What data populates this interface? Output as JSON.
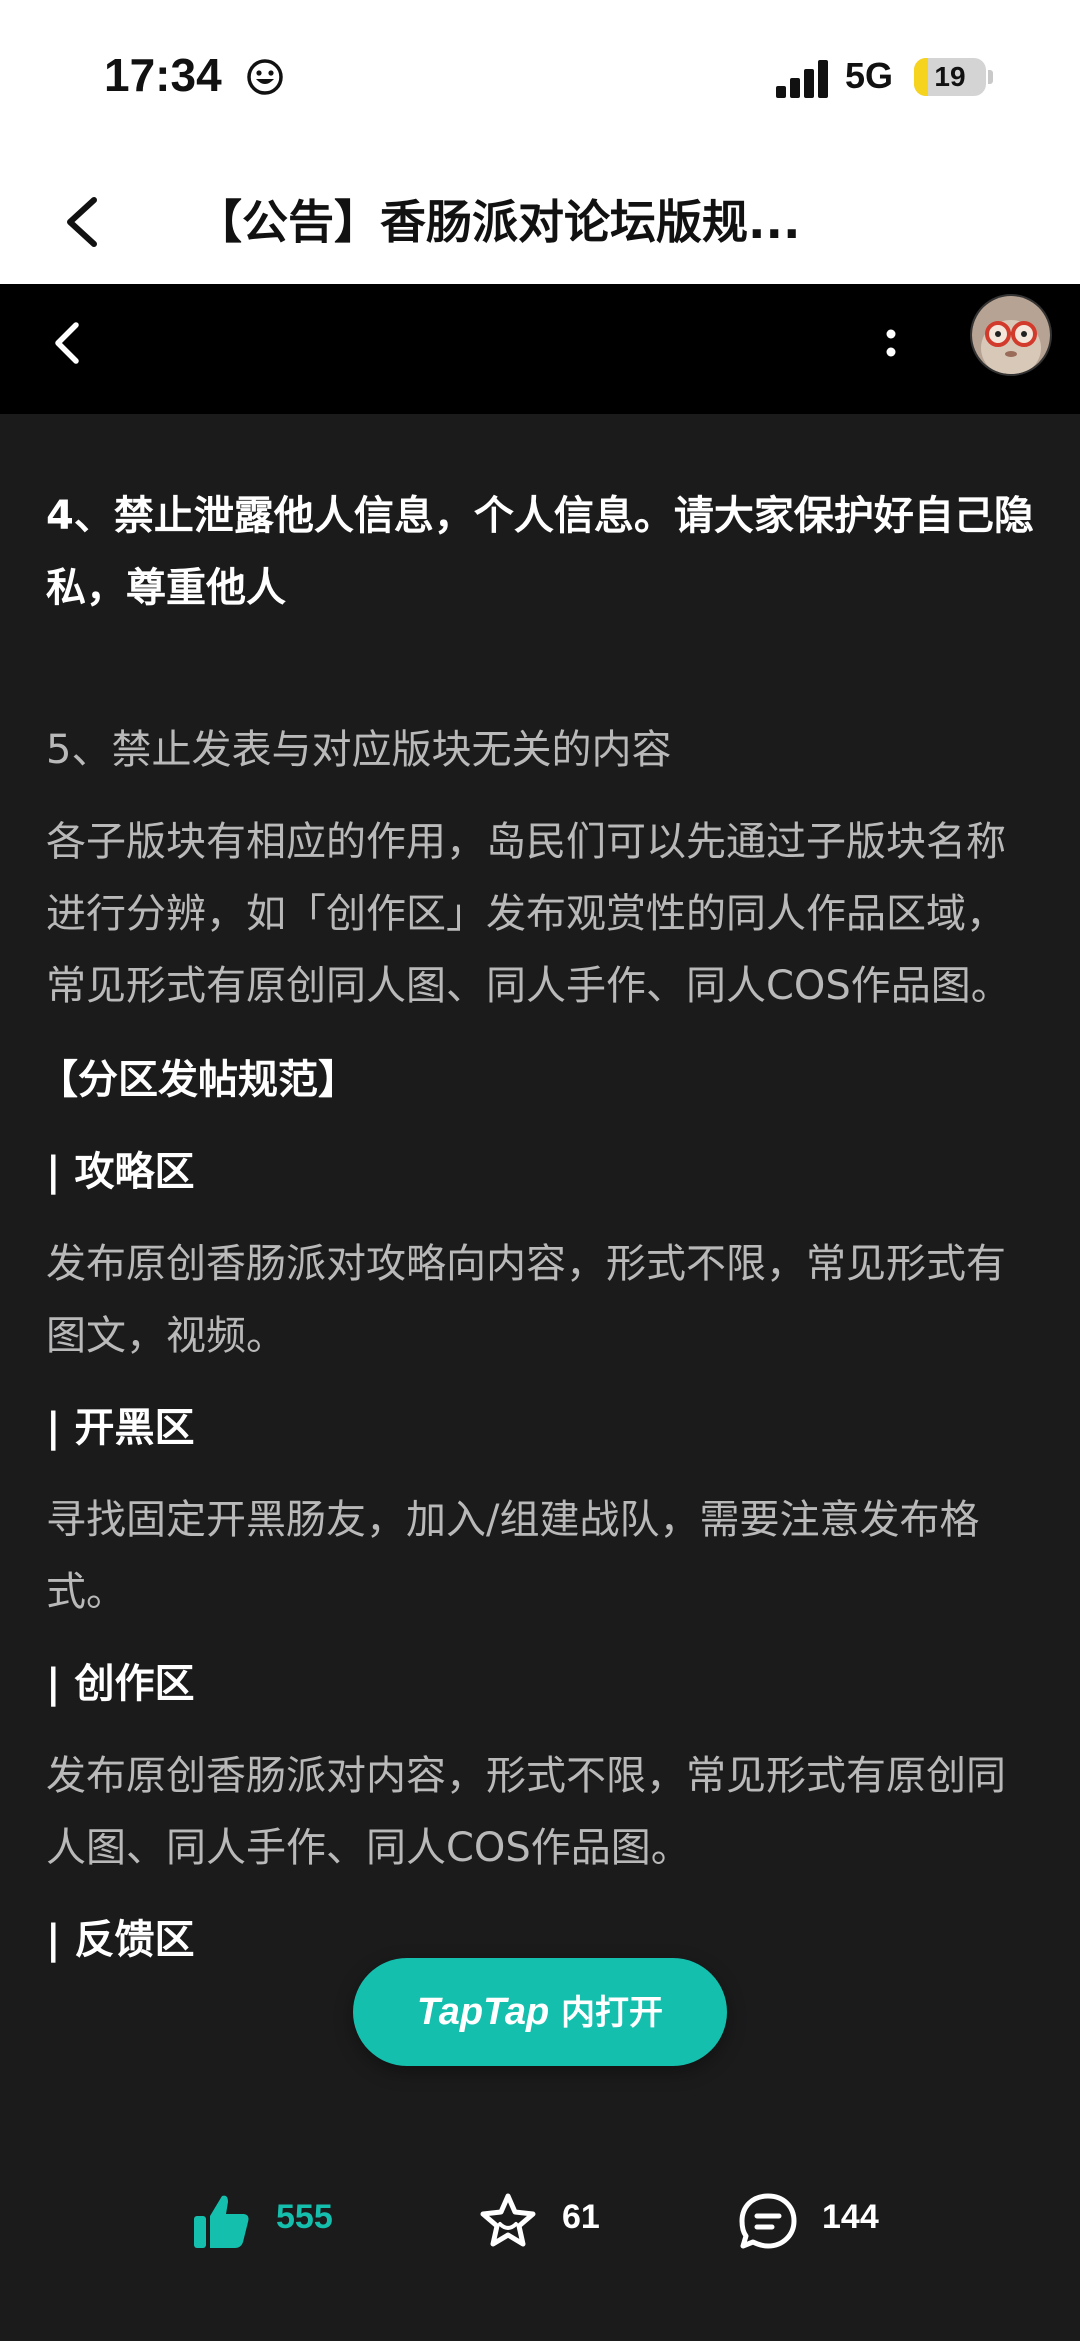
{
  "status_bar": {
    "time": "17:34",
    "network": "5G",
    "battery": "19",
    "battery_level": 0.19
  },
  "browser": {
    "title": "【公告】香肠派对论坛版规..."
  },
  "content": {
    "rule4": "4、禁止泄露他人信息，个人信息。请大家保护好自己隐私，尊重他人",
    "rule5_title": "5、禁止发表与对应版块无关的内容",
    "rule5_desc": "各子版块有相应的作用，岛民们可以先通过子版块名称进行分辨，如「创作区」发布观赏性的同人作品区域，常见形式有原创同人图、同人手作、同人COS作品图。",
    "section_heading": "【分区发帖规范】",
    "zones": [
      {
        "title": "| 攻略区",
        "desc": "发布原创香肠派对攻略向内容，形式不限，常见形式有图文，视频。"
      },
      {
        "title": "| 开黑区",
        "desc": "寻找固定开黑肠友，加入/组建战队，需要注意发布格式。"
      },
      {
        "title": "| 创作区",
        "desc": "发布原创香肠派对内容，形式不限，常见形式有原创同人图、同人手作、同人COS作品图。"
      },
      {
        "title": "| 反馈区",
        "desc": ""
      }
    ]
  },
  "open_button": {
    "brand": "TapTap",
    "label": " 内打开"
  },
  "actions": {
    "likes": "555",
    "favorites": "61",
    "comments": "144"
  },
  "icons": {
    "back": "chevron-left-icon",
    "more": "more-vertical-icon",
    "like": "thumbs-up-icon",
    "favorite": "star-icon",
    "comment": "comment-icon"
  },
  "colors": {
    "accent": "#14bfae",
    "background": "#1b1b1c"
  }
}
